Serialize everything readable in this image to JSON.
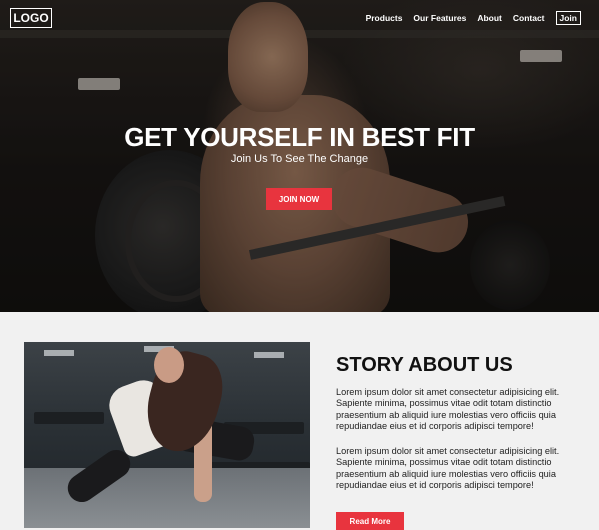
{
  "header": {
    "logo": "LOGO",
    "nav": [
      {
        "label": "Products"
      },
      {
        "label": "Our Features"
      },
      {
        "label": "About"
      },
      {
        "label": "Contact"
      },
      {
        "label": "Join"
      }
    ]
  },
  "hero": {
    "title": "GET YOURSELF IN BEST FIT",
    "subtitle": "Join Us To See The Change",
    "cta_label": "JOIN NOW"
  },
  "story": {
    "title": "STORY ABOUT US",
    "paragraphs": [
      "Lorem ipsum dolor sit amet consectetur adipisicing elit. Sapiente minima, possimus vitae odit totam distinctio praesentium ab aliquid iure molestias vero officiis quia repudiandae eius et id corporis adipisci tempore!",
      "Lorem ipsum dolor sit amet consectetur adipisicing elit. Sapiente minima, possimus vitae odit totam distinctio praesentium ab aliquid iure molestias vero officiis quia repudiandae eius et id corporis adipisci tempore!"
    ],
    "button_label": "Read More"
  },
  "colors": {
    "accent": "#e8343e",
    "page_background": "#f1f1f1",
    "text": "#111111"
  }
}
